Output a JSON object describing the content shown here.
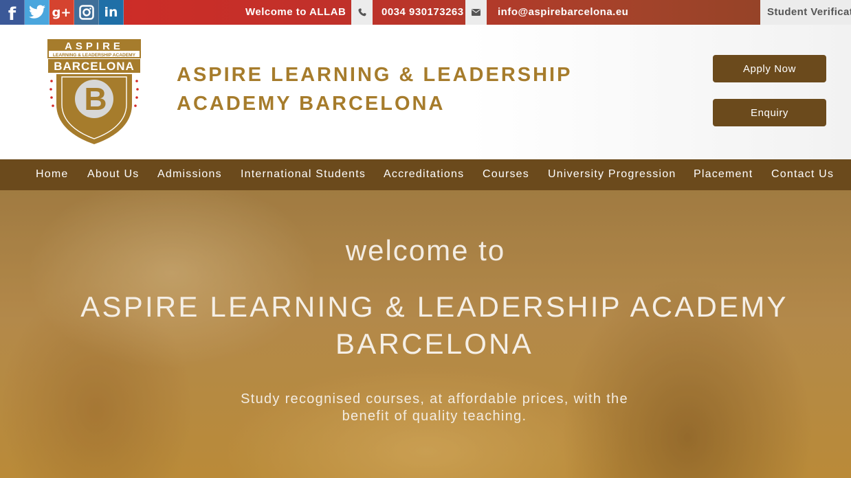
{
  "topbar": {
    "social": [
      {
        "icon": "facebook-icon",
        "glyph": "f"
      },
      {
        "icon": "twitter-icon",
        "glyph": ""
      },
      {
        "icon": "google-plus-icon",
        "glyph": "g+"
      },
      {
        "icon": "instagram-icon",
        "glyph": ""
      },
      {
        "icon": "linkedin-icon",
        "glyph": "in"
      }
    ],
    "welcome": "Welcome to ALLAB",
    "phone_icon": "phone-icon",
    "phone": "0034 930173263",
    "email_icon": "envelope-icon",
    "email": "info@aspirebarcelona.eu",
    "verification": "Student Verification"
  },
  "header": {
    "logo": {
      "top_word": "ASPIRE",
      "ribbon": "LEARNING & LEADERSHIP ACADEMY",
      "city": "BARCELONA",
      "letter": "B"
    },
    "brand_line1": "ASPIRE LEARNING & LEADERSHIP",
    "brand_line2": "ACADEMY BARCELONA",
    "apply": "Apply Now",
    "enquiry": "Enquiry"
  },
  "nav": {
    "items": [
      "Home",
      "About Us",
      "Admissions",
      "International Students",
      "Accreditations",
      "Courses",
      "University Progression",
      "Placement",
      "Contact Us"
    ]
  },
  "hero": {
    "small": "welcome to",
    "title": "ASPIRE LEARNING & LEADERSHIP ACADEMY BARCELONA",
    "subtitle": "Study recognised courses, at affordable prices, with the benefit of quality teaching."
  },
  "colors": {
    "brand_gold": "#a67c2c",
    "brand_brown": "#6b4a1c",
    "topbar_red": "#d42a26"
  }
}
